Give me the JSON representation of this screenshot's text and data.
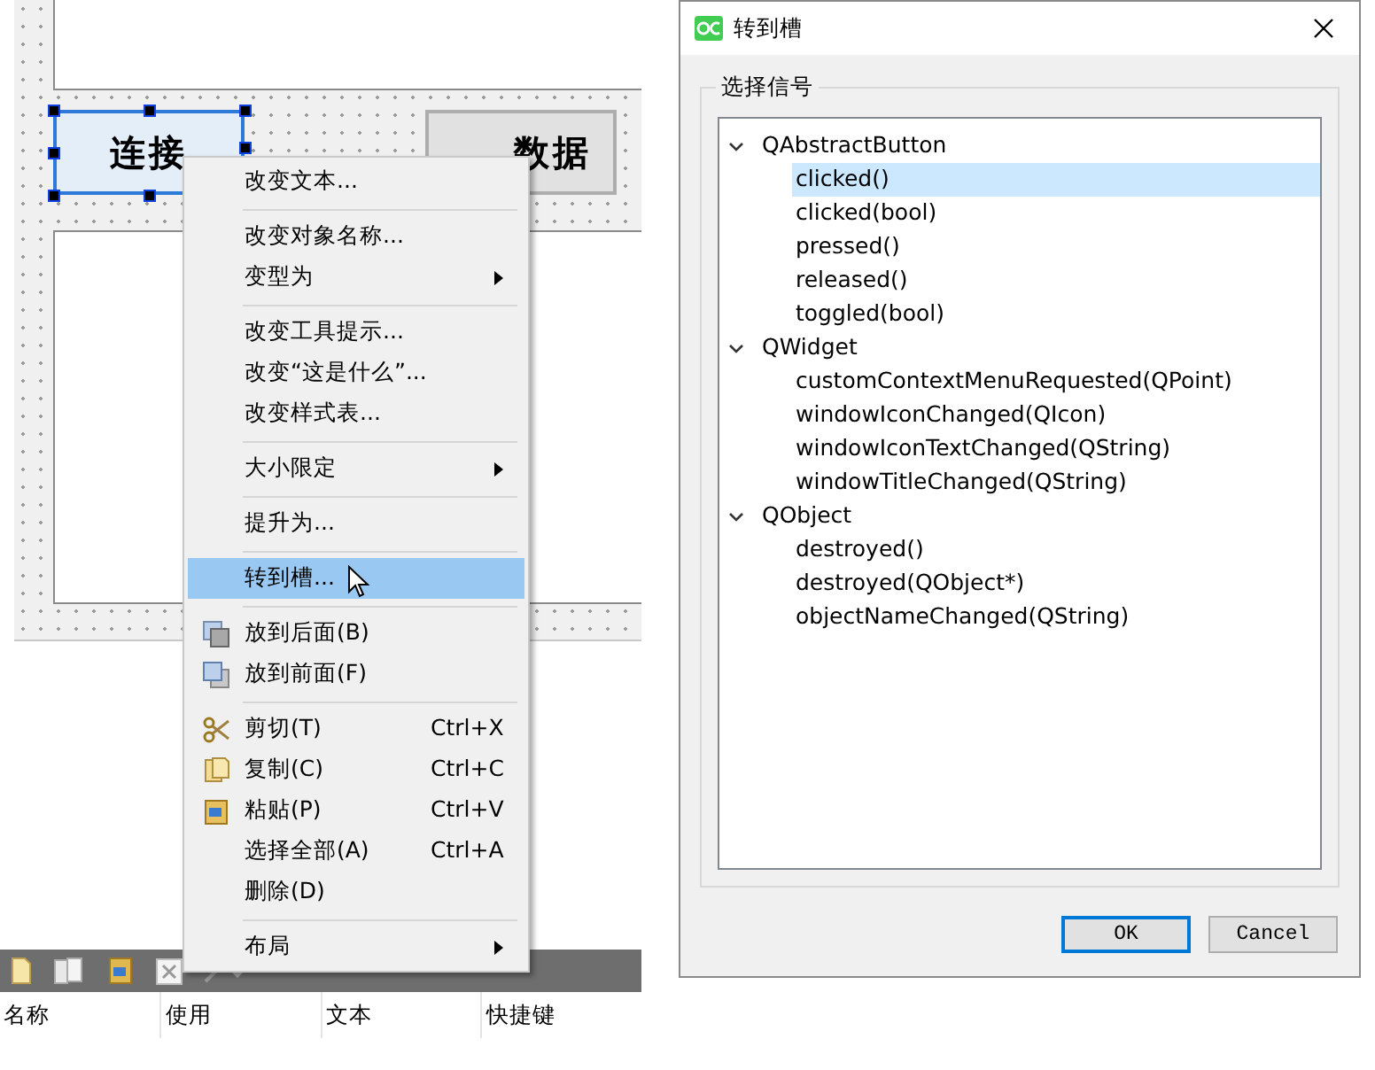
{
  "designer": {
    "buttons": [
      {
        "label": "连接",
        "selected": true
      },
      {
        "label": "数据",
        "selected": false
      }
    ]
  },
  "context_menu": {
    "items": [
      {
        "kind": "item",
        "label": "改变文本...",
        "highlighted": false
      },
      {
        "kind": "separator"
      },
      {
        "kind": "item",
        "label": "改变对象名称...",
        "highlighted": false
      },
      {
        "kind": "submenu",
        "label": "变型为",
        "highlighted": false
      },
      {
        "kind": "separator"
      },
      {
        "kind": "item",
        "label": "改变工具提示...",
        "highlighted": false
      },
      {
        "kind": "item",
        "label": "改变“这是什么”...",
        "highlighted": false
      },
      {
        "kind": "item",
        "label": "改变样式表...",
        "highlighted": false
      },
      {
        "kind": "separator"
      },
      {
        "kind": "submenu",
        "label": "大小限定",
        "highlighted": false
      },
      {
        "kind": "separator"
      },
      {
        "kind": "item",
        "label": "提升为...",
        "highlighted": false
      },
      {
        "kind": "separator"
      },
      {
        "kind": "item",
        "label": "转到槽...",
        "highlighted": true
      },
      {
        "kind": "separator"
      },
      {
        "kind": "item",
        "label": "放到后面(B)",
        "highlighted": false
      },
      {
        "kind": "item",
        "label": "放到前面(F)",
        "highlighted": false
      },
      {
        "kind": "separator"
      },
      {
        "kind": "item",
        "label": "剪切(T)",
        "shortcut": "Ctrl+X",
        "highlighted": false
      },
      {
        "kind": "item",
        "label": "复制(C)",
        "shortcut": "Ctrl+C",
        "highlighted": false
      },
      {
        "kind": "item",
        "label": "粘贴(P)",
        "shortcut": "Ctrl+V",
        "highlighted": false
      },
      {
        "kind": "item",
        "label": "选择全部(A)",
        "shortcut": "Ctrl+A",
        "highlighted": false
      },
      {
        "kind": "item",
        "label": "删除(D)",
        "highlighted": false
      },
      {
        "kind": "separator"
      },
      {
        "kind": "submenu",
        "label": "布局",
        "highlighted": false
      }
    ]
  },
  "action_table": {
    "columns": [
      "名称",
      "使用",
      "文本",
      "快捷键"
    ]
  },
  "dialog": {
    "title": "转到槽",
    "group_title": "选择信号",
    "tree": [
      {
        "label": "QAbstractButton",
        "expanded": true,
        "selected": false,
        "children": [
          {
            "label": "clicked()",
            "selected": true
          },
          {
            "label": "clicked(bool)",
            "selected": false
          },
          {
            "label": "pressed()",
            "selected": false
          },
          {
            "label": "released()",
            "selected": false
          },
          {
            "label": "toggled(bool)",
            "selected": false
          }
        ]
      },
      {
        "label": "QWidget",
        "expanded": true,
        "selected": false,
        "children": [
          {
            "label": "customContextMenuRequested(QPoint)",
            "selected": false
          },
          {
            "label": "windowIconChanged(QIcon)",
            "selected": false
          },
          {
            "label": "windowIconTextChanged(QString)",
            "selected": false
          },
          {
            "label": "windowTitleChanged(QString)",
            "selected": false
          }
        ]
      },
      {
        "label": "QObject",
        "expanded": true,
        "selected": false,
        "children": [
          {
            "label": "destroyed()",
            "selected": false
          },
          {
            "label": "destroyed(QObject*)",
            "selected": false
          },
          {
            "label": "objectNameChanged(QString)",
            "selected": false
          }
        ]
      }
    ],
    "buttons": [
      {
        "label": "OK",
        "default": true
      },
      {
        "label": "Cancel",
        "default": false
      }
    ]
  }
}
